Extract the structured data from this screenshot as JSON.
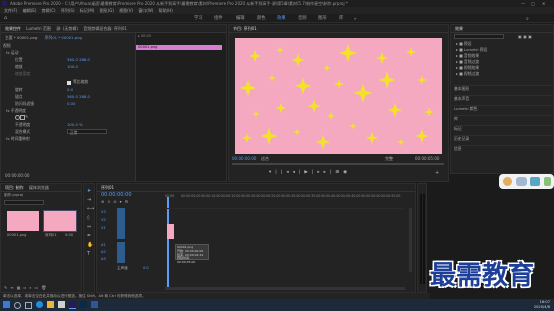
{
  "window": {
    "title": "Adobe Premiere Pro 2020 - C:\\用户\\Ahua\\桌面\\最需教育\\Premiere Pro 2020 从新手到高手\\最需教育\\素材\\Premiere Pro 2020 从新手到高手-源\\第5章\\素材\\5.7\\制作星空\\制作.prproj *"
  },
  "menu": [
    "文件(F)",
    "编辑(E)",
    "剪辑(C)",
    "序列(S)",
    "标记(M)",
    "图形(G)",
    "视图(V)",
    "窗口(W)",
    "帮助(H)"
  ],
  "workspaces": [
    {
      "label": "学习",
      "active": false
    },
    {
      "label": "组件",
      "active": false
    },
    {
      "label": "编辑",
      "active": false
    },
    {
      "label": "颜色",
      "active": false
    },
    {
      "label": "效果",
      "active": true
    },
    {
      "label": "音频",
      "active": false
    },
    {
      "label": "图形",
      "active": false
    },
    {
      "label": "库",
      "active": false
    }
  ],
  "effect_controls": {
    "tabs": [
      "效果控件",
      "Lumetri 范围",
      "源: (无剪辑)",
      "音频剪辑混合器: 序列01"
    ],
    "master": "主要 * 00001.png",
    "seq": "序列01 * 00001.png",
    "video_label": "视频",
    "rows": [
      {
        "label": "fx  运动",
        "value": ""
      },
      {
        "label": "位置",
        "value": "360.0   288.0"
      },
      {
        "label": "缩放",
        "value": "100.0"
      },
      {
        "label": "缩放宽度",
        "value": ""
      },
      {
        "label": "",
        "value": "等比缩放"
      },
      {
        "label": "旋转",
        "value": "0.0"
      },
      {
        "label": "锚点",
        "value": "360.0   288.0"
      },
      {
        "label": "防闪烁滤镜",
        "value": "0.00"
      },
      {
        "label": "fx  不透明度",
        "value": ""
      },
      {
        "label": "",
        "value": ""
      },
      {
        "label": "不透明度",
        "value": "100.0 %"
      },
      {
        "label": "混合模式",
        "value": "正常"
      },
      {
        "label": "fx  时间重映射",
        "value": ""
      }
    ],
    "clip_name": "00001.png",
    "timecode": "00:00:00:00"
  },
  "program": {
    "title": "节目: 序列01",
    "timecode_left": "00:00:00:00",
    "fit": "适合",
    "quality": "完整",
    "timecode_right": "00:00:05:00"
  },
  "effects_panel": {
    "title": "效果",
    "items": [
      "预设",
      "Lumetri 预设",
      "音频效果",
      "音频过渡",
      "视频效果",
      "视频过渡"
    ],
    "sections": [
      "基本图形",
      "基本声音",
      "Lumetri 颜色",
      "库",
      "标记",
      "历史记录",
      "信息"
    ]
  },
  "project": {
    "tabs": [
      "项目: 制作",
      "媒体浏览器"
    ],
    "search_placeholder": "",
    "project_name": "制作.prproj",
    "items": [
      {
        "name": "00001.png",
        "duration": ""
      },
      {
        "name": "序列01",
        "duration": "5:00"
      }
    ]
  },
  "timeline": {
    "tab": "序列01",
    "timecode": "00:00:00:00",
    "ruler": [
      "00:00",
      "00:00:05:00",
      "00:00:10:00",
      "00:00:15:00",
      "00:00:20:00",
      "00:00:25:00",
      "00:00:30:00",
      "00:00:35:00",
      "00:00:40:00",
      "00:00:45:00",
      "00:00:50:00",
      "00:00:55:00"
    ],
    "tracks_video": [
      "V3",
      "V2",
      "V1"
    ],
    "tracks_audio": [
      "A1",
      "A2",
      "A3"
    ],
    "master": "主声道",
    "master_value": "0.0",
    "clip_label": "00001.png",
    "tooltip": [
      "00001.png",
      "开始: 00:00:00:00",
      "结束: 00:00:04:24",
      "持续时间: 00:00:05:00"
    ]
  },
  "status": {
    "text": "单击以选择，或单击空白处并拖动以进行框选。按住 Shift、Alt 和 Ctrl 可获得其他选项。"
  },
  "watermark": {
    "text": "最需教育"
  },
  "clock": {
    "time": "16:07",
    "date": "2020/4/8"
  },
  "colors": {
    "accent": "#5b9cf5",
    "canvas_pink": "#f4a9c1",
    "star": "#f2e22a",
    "watermark": "#1d3f9a"
  }
}
